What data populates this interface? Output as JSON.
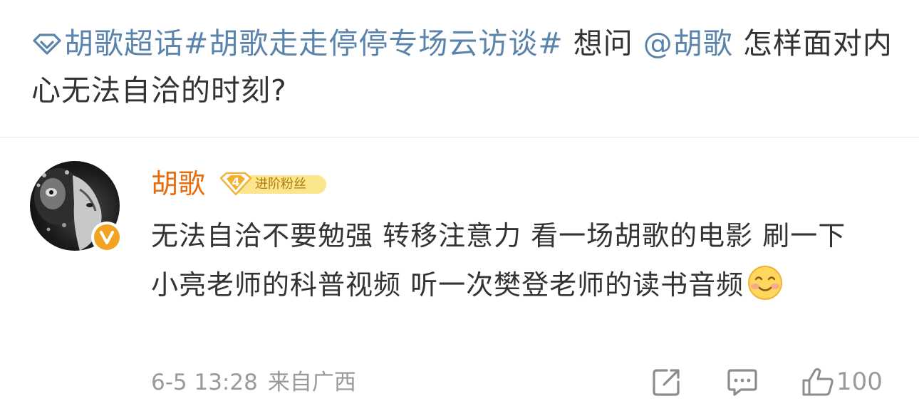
{
  "post": {
    "supertopic": "胡歌超话",
    "hashtag": "#胡歌走走停停专场云访谈#",
    "text_before_mention": " 想问 ",
    "mention": "@胡歌",
    "text_after_mention": " 怎样面对内心无法自洽的时刻?"
  },
  "reply": {
    "username": "胡歌",
    "fan_level": "4",
    "fan_badge_label": "进阶粉丝",
    "content": "无法自洽不要勉强 转移注意力 看一场胡歌的电影 刷一下小亮老师的科普视频 听一次樊登老师的读书音频",
    "emoji": "smile-emoji",
    "time": "6-5 13:28",
    "source": "来自广西",
    "like_count": "100"
  },
  "colors": {
    "link": "#5b84ad",
    "username": "#e86b0c",
    "meta": "#9a9a9a",
    "badge": "#fbe68e",
    "verified": "#f2a321"
  }
}
